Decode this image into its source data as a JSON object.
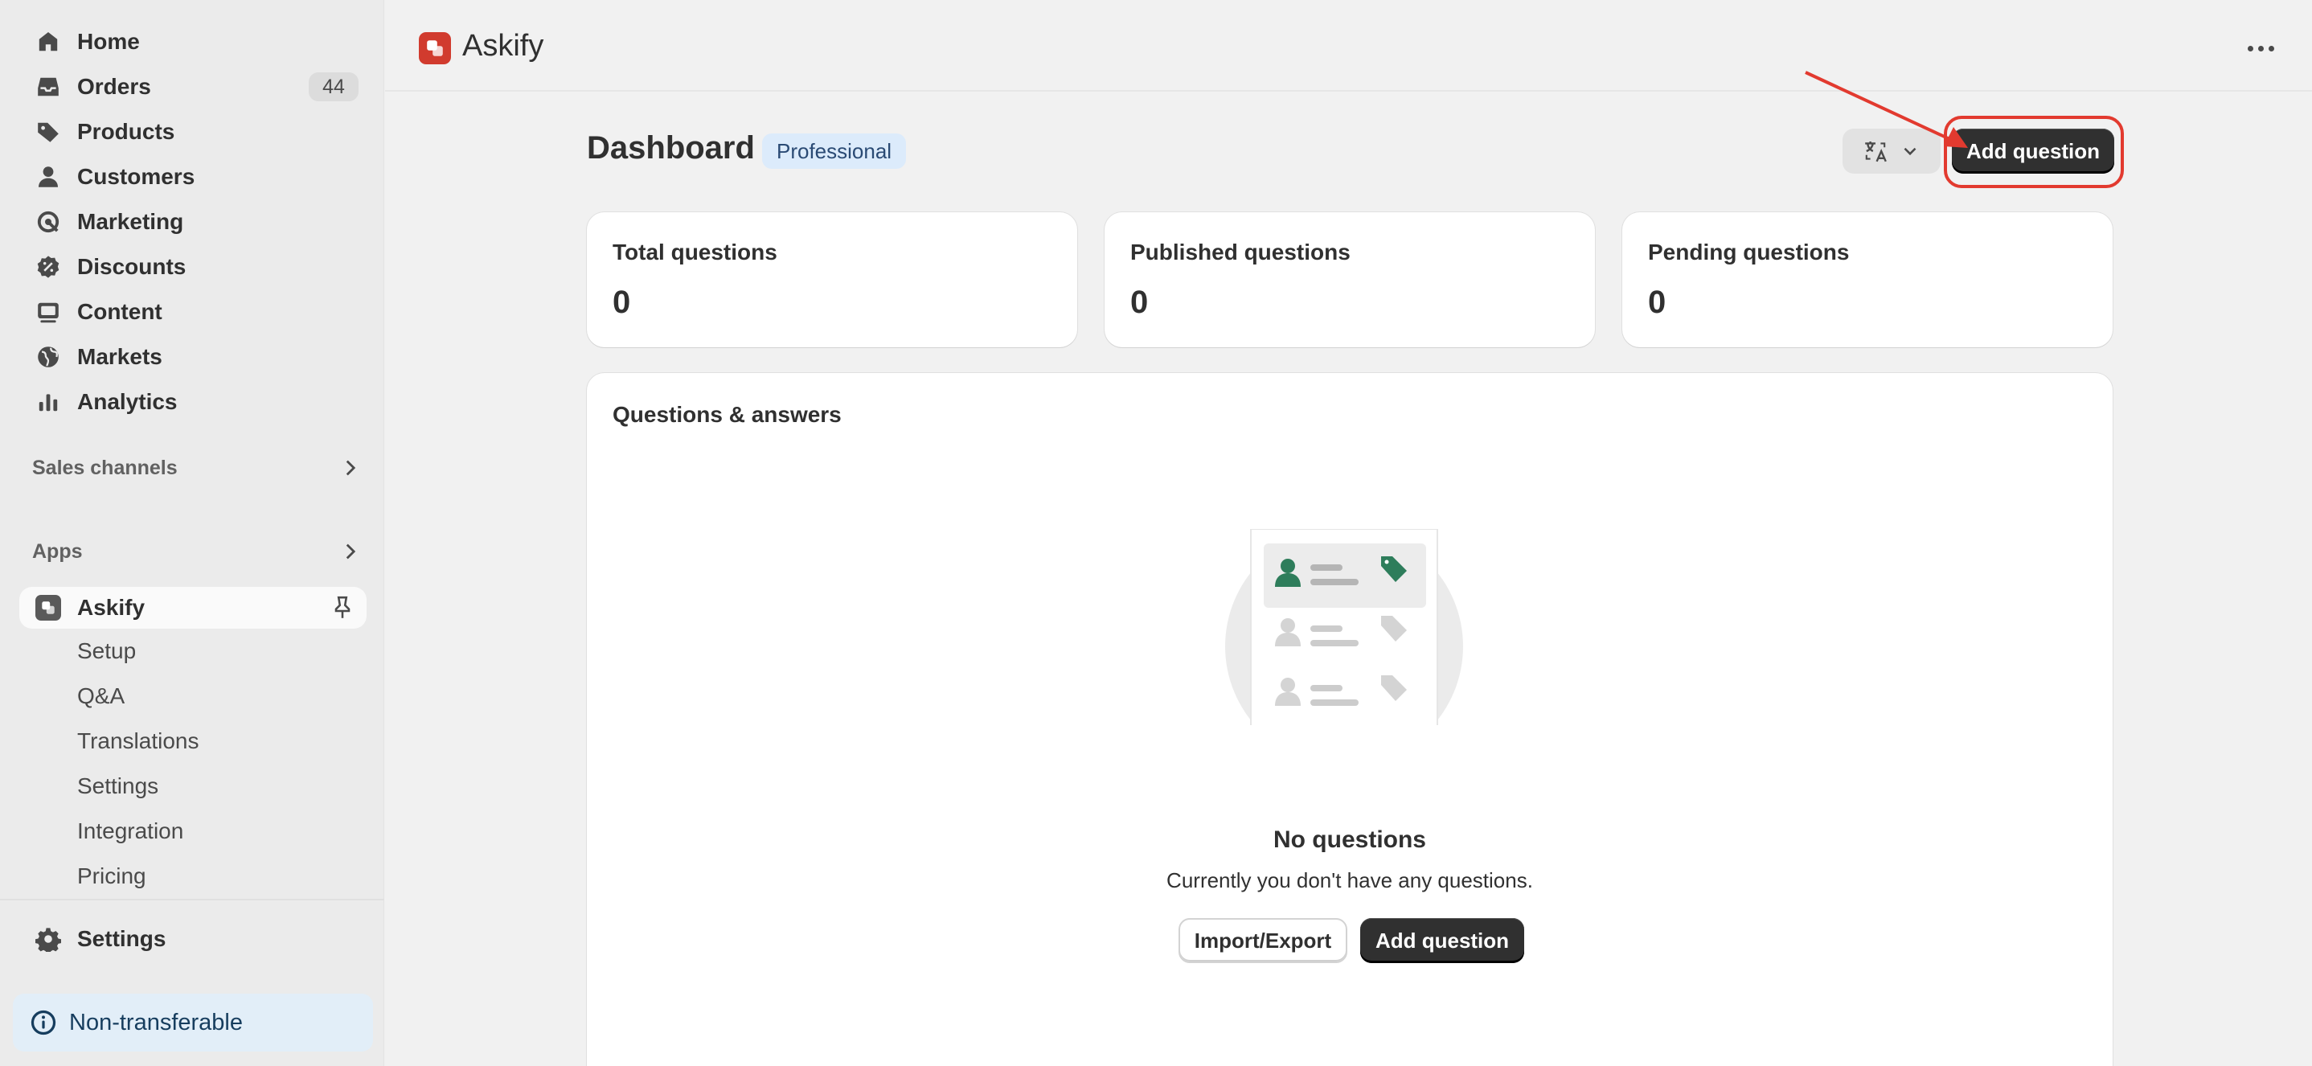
{
  "sidebar": {
    "nav": [
      {
        "label": "Home",
        "icon": "home-icon"
      },
      {
        "label": "Orders",
        "icon": "inbox-icon",
        "count": "44"
      },
      {
        "label": "Products",
        "icon": "tag-icon"
      },
      {
        "label": "Customers",
        "icon": "person-icon"
      },
      {
        "label": "Marketing",
        "icon": "target-icon"
      },
      {
        "label": "Discounts",
        "icon": "discount-icon"
      },
      {
        "label": "Content",
        "icon": "image-icon"
      },
      {
        "label": "Markets",
        "icon": "globe-icon"
      },
      {
        "label": "Analytics",
        "icon": "bar-chart-icon"
      }
    ],
    "sales_channels_label": "Sales channels",
    "apps_label": "Apps",
    "app": {
      "label": "Askify",
      "subitems": [
        "Setup",
        "Q&A",
        "Translations",
        "Settings",
        "Integration",
        "Pricing"
      ]
    },
    "settings_label": "Settings",
    "non_transferable_label": "Non-transferable"
  },
  "topbar": {
    "app_title": "Askify"
  },
  "page": {
    "title": "Dashboard",
    "plan_badge": "Professional",
    "add_question_label": "Add question"
  },
  "stats": [
    {
      "label": "Total questions",
      "value": "0"
    },
    {
      "label": "Published questions",
      "value": "0"
    },
    {
      "label": "Pending questions",
      "value": "0"
    }
  ],
  "qa": {
    "title": "Questions & answers",
    "empty_title": "No questions",
    "empty_description": "Currently you don't have any questions.",
    "import_export_label": "Import/Export",
    "add_question_label": "Add question"
  },
  "colors": {
    "accent_red": "#e23a2f",
    "primary_button": "#303030",
    "brand_logo": "#d13b2e",
    "info_banner": "#e2eef8"
  }
}
